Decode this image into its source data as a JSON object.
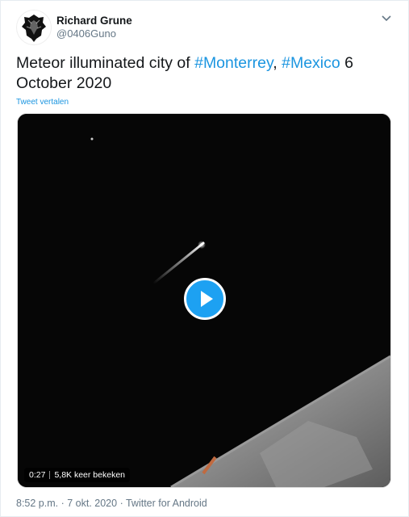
{
  "author": {
    "name": "Richard Grune",
    "handle": "@0406Guno"
  },
  "tweet": {
    "text_before": "Meteor illuminated city of ",
    "hashtag1": "#Monterrey",
    "comma": ", ",
    "hashtag2": "#Mexico",
    "text_after": " 6 October 2020",
    "translate_label": "Tweet vertalen"
  },
  "video": {
    "duration": "0:27",
    "views": "5,8K keer bekeken"
  },
  "footer": {
    "time": "8:52 p.m.",
    "date": "7 okt. 2020",
    "dot1": " · ",
    "dot2": " · ",
    "source": "Twitter for Android"
  },
  "colors": {
    "accent": "#1b95e0",
    "play_button": "#1da1f2"
  },
  "icons": {
    "caret": "chevron-down-icon",
    "play": "play-icon",
    "avatar": "lion-logo-icon"
  }
}
